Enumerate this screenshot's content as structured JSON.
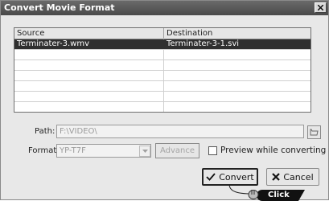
{
  "window": {
    "title": "Convert Movie Format"
  },
  "list": {
    "columns": [
      "Source",
      "Destination"
    ],
    "rows": [
      {
        "source": "Terminater-3.wmv",
        "destination": "Terminater-3-1.svi",
        "selected": true
      }
    ]
  },
  "path": {
    "label": "Path:",
    "value": "F:\\VIDEO\\"
  },
  "format": {
    "label": "Format:",
    "value": "YP-T7F",
    "advance_label": "Advance"
  },
  "preview": {
    "label": "Preview while converting",
    "checked": false
  },
  "buttons": {
    "convert_label": "Convert",
    "cancel_label": "Cancel"
  },
  "callout": {
    "label": "Click"
  },
  "icons": {
    "close": "close-icon",
    "browse": "folder-browse-icon",
    "convert": "checkmark-icon",
    "cancel": "x-icon",
    "combo": "chevron-down-icon",
    "cursor": "hand-cursor-icon"
  },
  "colors": {
    "titlebar": "#4a4a4a",
    "selection": "#2f2f2f",
    "callout": "#111111"
  }
}
